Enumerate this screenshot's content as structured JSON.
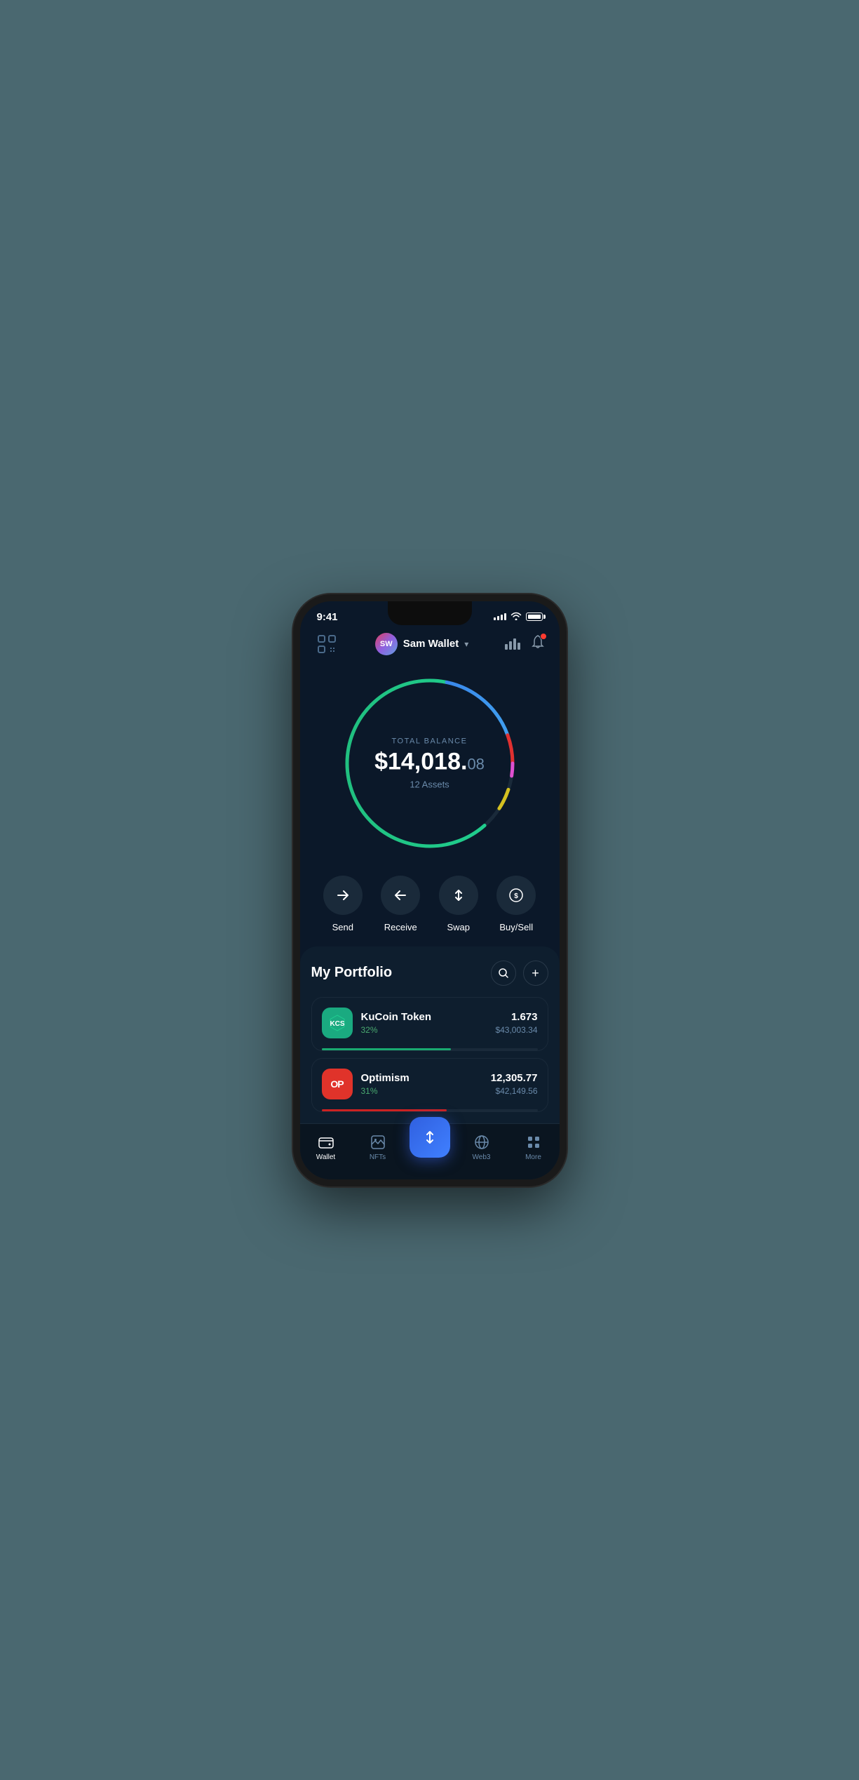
{
  "statusBar": {
    "time": "9:41",
    "signalBars": [
      3,
      5,
      7,
      9
    ],
    "batteryLevel": 85
  },
  "header": {
    "scanIconLabel": "scan",
    "avatarInitials": "SW",
    "walletName": "Sam Wallet",
    "dropdownLabel": "▾",
    "chartIconLabel": "chart",
    "bellIconLabel": "bell"
  },
  "balance": {
    "label": "TOTAL BALANCE",
    "amountMain": "$14,018.",
    "amountCents": "08",
    "assetsLabel": "12 Assets"
  },
  "actions": [
    {
      "id": "send",
      "icon": "→",
      "label": "Send"
    },
    {
      "id": "receive",
      "icon": "←",
      "label": "Receive"
    },
    {
      "id": "swap",
      "icon": "⇅",
      "label": "Swap"
    },
    {
      "id": "buysell",
      "icon": "💲",
      "label": "Buy/Sell"
    }
  ],
  "portfolio": {
    "title": "My Portfolio",
    "searchLabel": "🔍",
    "addLabel": "+"
  },
  "assets": [
    {
      "id": "kucoin",
      "name": "KuCoin Token",
      "percent": "32%",
      "amount": "1.673",
      "usdValue": "$43,003.34",
      "progressClass": "kucoin-progress",
      "iconClass": "kucoin-icon",
      "iconText": "⬡"
    },
    {
      "id": "optimism",
      "name": "Optimism",
      "percent": "31%",
      "amount": "12,305.77",
      "usdValue": "$42,149.56",
      "progressClass": "optimism-progress",
      "iconClass": "optimism-icon",
      "iconText": "OP"
    }
  ],
  "bottomNav": [
    {
      "id": "wallet",
      "icon": "👛",
      "label": "Wallet",
      "active": true
    },
    {
      "id": "nfts",
      "icon": "🖼",
      "label": "NFTs",
      "active": false
    },
    {
      "id": "center",
      "icon": "⇅",
      "label": "",
      "active": false
    },
    {
      "id": "web3",
      "icon": "🌐",
      "label": "Web3",
      "active": false
    },
    {
      "id": "more",
      "icon": "⋮⋮",
      "label": "More",
      "active": false
    }
  ]
}
